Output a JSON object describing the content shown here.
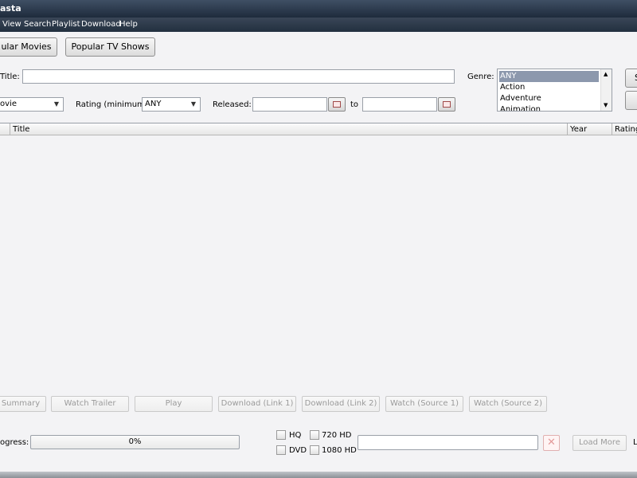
{
  "window": {
    "title": "asta"
  },
  "menu": [
    "View",
    "Search",
    "Playlist",
    "Download",
    "Help"
  ],
  "top_buttons": {
    "popular_movies": "ular Movies",
    "popular_tv": "Popular TV Shows"
  },
  "search": {
    "title_label": "Title:",
    "title_value": "",
    "type_value": "ovie",
    "rating_label": "Rating (minimum):",
    "rating_value": "ANY",
    "released_label": "Released:",
    "released_from": "",
    "to_label": "to",
    "released_to": "",
    "genre_label": "Genre:",
    "genres": [
      "ANY",
      "Action",
      "Adventure",
      "Animation"
    ],
    "selected_genre": "ANY",
    "side_button_label": "S"
  },
  "table": {
    "columns": {
      "title": "Title",
      "year": "Year",
      "rating": "Rating"
    },
    "rows": []
  },
  "action_buttons": [
    "Summary",
    "Watch Trailer",
    "Play",
    "Download (Link 1)",
    "Download (Link 2)",
    "Watch (Source 1)",
    "Watch (Source 2)"
  ],
  "status": {
    "progress_label": "ogress:",
    "progress_value": "0%",
    "quality": {
      "hq": "HQ",
      "hd720": "720 HD",
      "dvd": "DVD",
      "hd1080": "1080 HD"
    },
    "load_more": "Load More",
    "edge_text": "L"
  },
  "colors": {
    "titlebar": "#2b3a4d",
    "selection": "#8c98ad",
    "cancel_red": "#d94a4a"
  },
  "icons": {
    "calendar": "calendar-icon",
    "cancel": "cancel-x-icon",
    "dropdown": "chevron-down-icon"
  }
}
